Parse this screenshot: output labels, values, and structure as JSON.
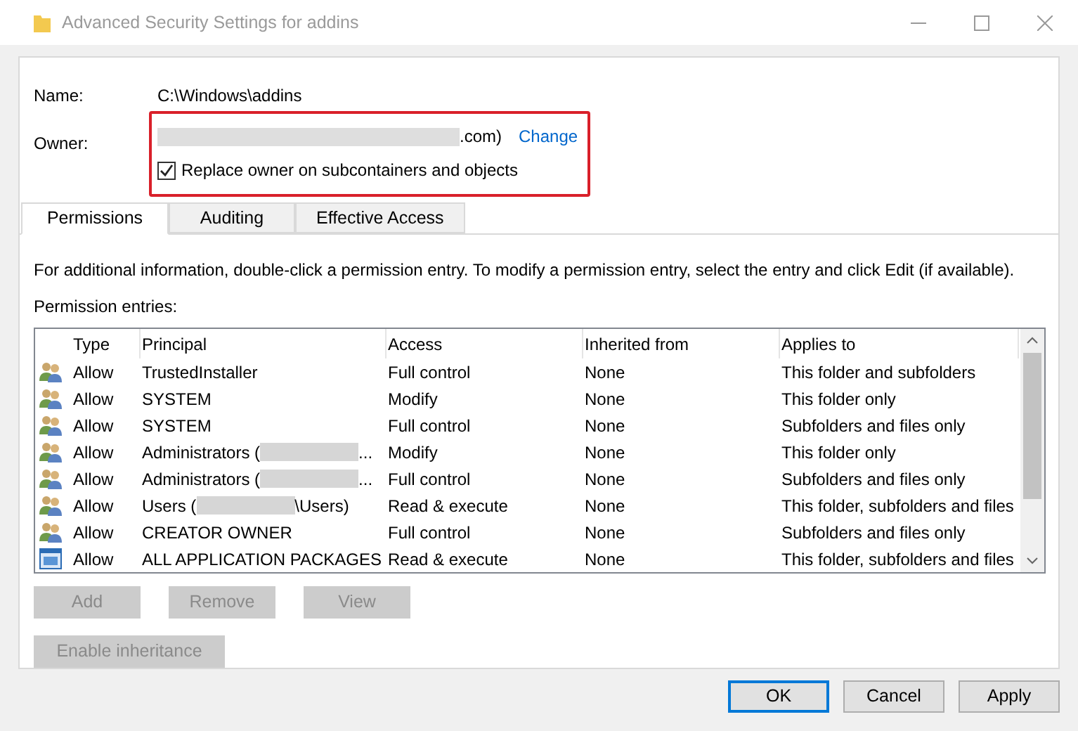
{
  "window": {
    "title": "Advanced Security Settings for addins"
  },
  "name": {
    "label": "Name:",
    "value": "C:\\Windows\\addins"
  },
  "owner": {
    "label": "Owner:",
    "redacted": true,
    "value": ".com)",
    "link": "Change"
  },
  "replace_owner": {
    "label": "Replace owner on subcontainers and objects",
    "checked": true
  },
  "tabs": [
    {
      "label": "Permissions",
      "selected": true
    },
    {
      "label": "Auditing",
      "selected": false
    },
    {
      "label": "Effective Access",
      "selected": false
    }
  ],
  "info": "For additional information, double-click a permission entry. To modify a permission entry, select the entry and click Edit (if available).",
  "entries_label": "Permission entries:",
  "table": {
    "columns": [
      "Type",
      "Principal",
      "Access",
      "Inherited from",
      "Applies to"
    ],
    "rows": [
      {
        "kind": "users",
        "type": "Allow",
        "principal": "TrustedInstaller",
        "redacted": false,
        "access": "Full control",
        "inherited": "None",
        "applies": "This folder and subfolders"
      },
      {
        "kind": "users",
        "type": "Allow",
        "principal": "SYSTEM",
        "redacted": false,
        "access": "Modify",
        "inherited": "None",
        "applies": "This folder only"
      },
      {
        "kind": "users",
        "type": "Allow",
        "principal": "SYSTEM",
        "redacted": false,
        "access": "Full control",
        "inherited": "None",
        "applies": "Subfolders and files only"
      },
      {
        "kind": "users",
        "type": "Allow",
        "principal": "Administrators (",
        "redacted": true,
        "suffix": "...",
        "access": "Modify",
        "inherited": "None",
        "applies": "This folder only"
      },
      {
        "kind": "users",
        "type": "Allow",
        "principal": "Administrators (",
        "redacted": true,
        "suffix": "...",
        "access": "Full control",
        "inherited": "None",
        "applies": "Subfolders and files only"
      },
      {
        "kind": "users",
        "type": "Allow",
        "principal": "Users (",
        "redacted": true,
        "suffix": "\\Users)",
        "access": "Read & execute",
        "inherited": "None",
        "applies": "This folder, subfolders and files"
      },
      {
        "kind": "users",
        "type": "Allow",
        "principal": "CREATOR OWNER",
        "redacted": false,
        "access": "Full control",
        "inherited": "None",
        "applies": "Subfolders and files only"
      },
      {
        "kind": "package",
        "type": "Allow",
        "principal": "ALL APPLICATION PACKAGES",
        "redacted": false,
        "access": "Read & execute",
        "inherited": "None",
        "applies": "This folder, subfolders and files"
      }
    ]
  },
  "entry_buttons": [
    {
      "label": "Add",
      "disabled": true
    },
    {
      "label": "Remove",
      "disabled": true
    },
    {
      "label": "View",
      "disabled": true
    }
  ],
  "inheritance_button": {
    "label": "Enable inheritance",
    "disabled": true
  },
  "dialog_buttons": [
    {
      "label": "OK",
      "default": true
    },
    {
      "label": "Cancel",
      "default": false
    },
    {
      "label": "Apply",
      "default": false
    }
  ]
}
